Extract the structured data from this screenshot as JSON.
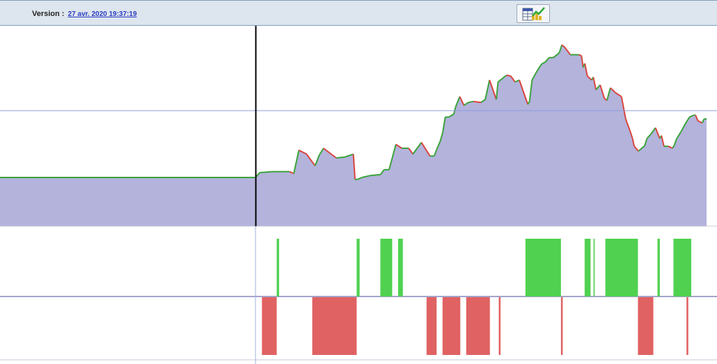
{
  "header": {
    "version_label": "Version :",
    "version_value": "27 avr. 2020 19:37:19",
    "chart_button_icon": "table-chart-icon"
  },
  "colors": {
    "header_bg": "#dde5ee",
    "area_fill": "#b3b3dc",
    "price_line": "#3aa33a",
    "down_line": "#d9453e",
    "buy_bar": "#50d150",
    "sell_bar": "#e06262",
    "cursor_line": "#000000",
    "h_gridline": "#8e9bdc"
  },
  "chart_data": [
    {
      "type": "area",
      "x": [
        0,
        35,
        40,
        55,
        75,
        80,
        86,
        95,
        105,
        110,
        115,
        130,
        140,
        150,
        152,
        155,
        160,
        170,
        182,
        186,
        192,
        200,
        207,
        215,
        220,
        230,
        240,
        245,
        248,
        252,
        255,
        258,
        262,
        268,
        270,
        275,
        280,
        285,
        291,
        300,
        305,
        310,
        318,
        320,
        330,
        335,
        340,
        345,
        355,
        357,
        360,
        365,
        370,
        372,
        375,
        380,
        385,
        392,
        395,
        398,
        405,
        415,
        418,
        420,
        422,
        425,
        430,
        432,
        435,
        440,
        445,
        448,
        452,
        458,
        465,
        470,
        475,
        478,
        480,
        485,
        490,
        492,
        495,
        500,
        505,
        510,
        512,
        515,
        520,
        525,
        527,
        530,
        535,
        540,
        545,
        550,
        552,
        555,
        560,
        562,
        565
      ],
      "y": [
        50,
        50,
        55,
        56,
        56,
        54,
        78,
        74,
        62,
        73,
        80,
        70,
        71,
        74,
        48,
        48,
        50,
        52,
        53,
        58,
        58,
        84,
        80,
        80,
        74,
        86,
        72,
        72,
        79,
        87,
        96,
        112,
        112,
        115,
        122,
        133,
        124,
        127,
        128,
        127,
        130,
        150,
        130,
        148,
        155,
        154,
        148,
        150,
        125,
        128,
        150,
        158,
        165,
        167,
        168,
        173,
        173,
        178,
        186,
        184,
        176,
        176,
        175,
        163,
        167,
        154,
        150,
        153,
        140,
        145,
        131,
        129,
        142,
        137,
        133,
        110,
        98,
        90,
        82,
        77,
        81,
        82,
        90,
        95,
        101,
        90,
        93,
        82,
        82,
        80,
        83,
        90,
        97,
        105,
        112,
        114,
        114,
        108,
        106,
        110,
        110
      ],
      "ylim": [
        0,
        200
      ],
      "split_x": 35
    },
    {
      "type": "bar",
      "name": "buy",
      "intervals": [
        [
          3,
          3.4
        ],
        [
          16.5,
          17
        ],
        [
          20.5,
          22.5
        ],
        [
          23.5,
          24.3
        ],
        [
          45,
          51
        ],
        [
          55,
          56
        ],
        [
          56.5,
          56.7
        ],
        [
          58.5,
          64
        ],
        [
          67.3,
          67.7
        ],
        [
          70,
          73
        ]
      ],
      "value": 1
    },
    {
      "type": "bar",
      "name": "sell",
      "intervals": [
        [
          0.5,
          3
        ],
        [
          9,
          16.5
        ],
        [
          28.3,
          30
        ],
        [
          31,
          34
        ],
        [
          35,
          39
        ],
        [
          40.5,
          40.8
        ],
        [
          51,
          51.3
        ],
        [
          64,
          66.6
        ],
        [
          72.2,
          72.5
        ]
      ],
      "value": 1
    }
  ]
}
